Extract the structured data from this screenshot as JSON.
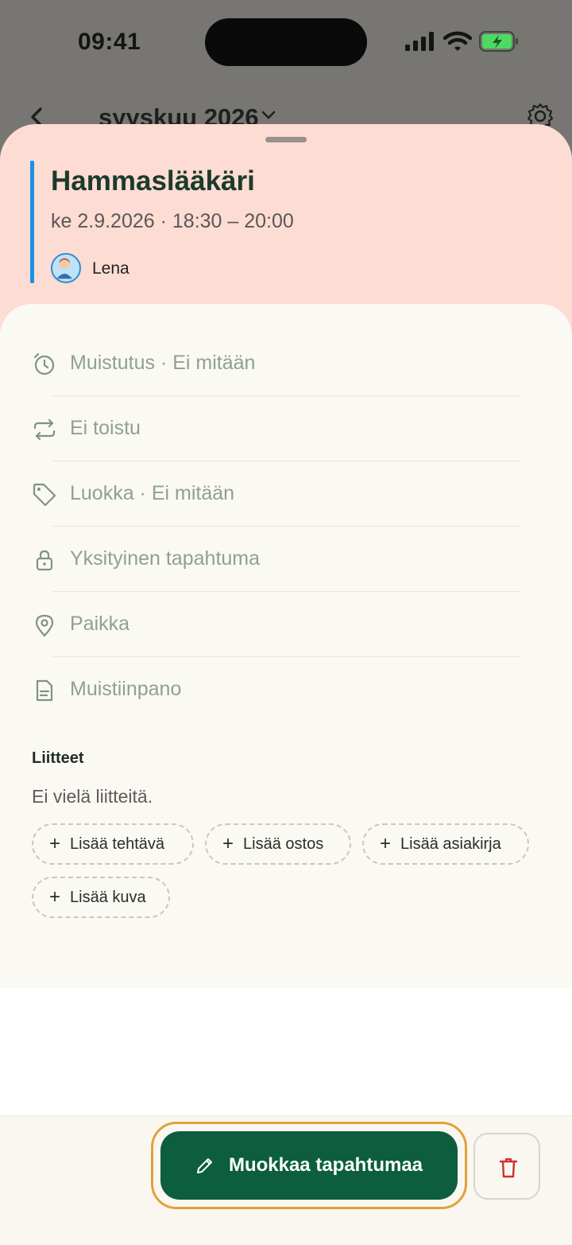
{
  "status_bar": {
    "time": "09:41"
  },
  "background_header": {
    "title": "syyskuu 2026"
  },
  "event": {
    "title": "Hammaslääkäri",
    "datetime": "ke 2.9.2026 · 18:30 – 20:00",
    "person": "Lena",
    "accent_color": "#1b8fe0"
  },
  "details": {
    "reminder": "Muistutus · Ei mitään",
    "repeat": "Ei toistu",
    "category": "Luokka · Ei mitään",
    "private": "Yksityinen tapahtuma",
    "location": "Paikka",
    "note": "Muistiinpano"
  },
  "attachments": {
    "title": "Liitteet",
    "empty_text": "Ei vielä liitteitä.",
    "add_task": "Lisää tehtävä",
    "add_purchase": "Lisää ostos",
    "add_document": "Lisää asiakirja",
    "add_image": "Lisää kuva"
  },
  "actions": {
    "edit_label": "Muokkaa tapahtumaa",
    "primary_color": "#0c5e3f",
    "delete_color": "#d12f2f"
  },
  "icons": [
    "alarm-clock-icon",
    "repeat-icon",
    "tag-icon",
    "lock-icon",
    "map-pin-icon",
    "document-icon",
    "pencil-icon",
    "trash-icon",
    "gear-icon",
    "chevron-left-icon",
    "chevron-down-icon"
  ]
}
